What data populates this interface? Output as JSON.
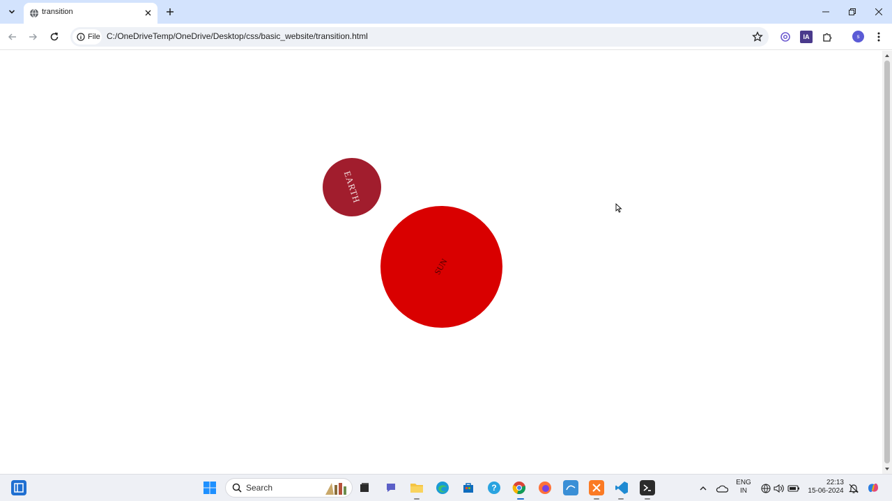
{
  "browser": {
    "tab": {
      "title": "transition",
      "favicon": "globe-icon"
    },
    "address_bar": {
      "security_chip_label": "File",
      "url": "C:/OneDriveTemp/OneDrive/Desktop/css/basic_website/transition.html"
    },
    "profile_initial": "s",
    "extensions": [
      {
        "name": "mention-icon"
      },
      {
        "name": "ia-extension-icon",
        "label": "IA"
      },
      {
        "name": "puzzle-icon"
      }
    ]
  },
  "page": {
    "earth": {
      "label": "EARTH",
      "color": "#a11d2d"
    },
    "sun": {
      "label": "SUN",
      "color": "#d90000"
    }
  },
  "taskbar": {
    "search_placeholder": "Search",
    "apps": [
      "widgets-icon",
      "windows-start-icon",
      "search-icon",
      "task-view-icon",
      "chat-icon",
      "file-explorer-icon",
      "edge-icon",
      "store-icon",
      "help-icon",
      "chrome-icon",
      "firefox-icon",
      "mysql-workbench-icon",
      "xampp-icon",
      "vscode-icon",
      "terminal-icon"
    ],
    "tray": {
      "language": "ENG",
      "region": "IN",
      "time": "22:13",
      "date": "15-06-2024"
    }
  }
}
